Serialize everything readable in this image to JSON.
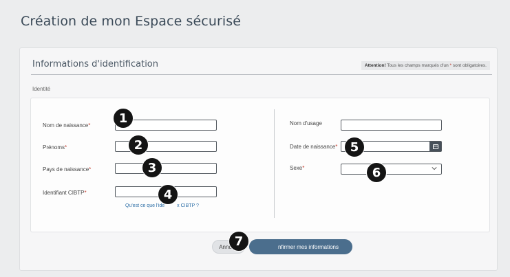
{
  "page": {
    "title": "Création de mon Espace sécurisé"
  },
  "section": {
    "title": "Informations d'identification",
    "note_bold": "Attention!",
    "note_pre": " Tous les champs marqués d'un ",
    "note_star": "*",
    "note_post": " sont obligatoires.",
    "subsection": "Identité"
  },
  "fields": {
    "nom_naissance": {
      "label": "Nom de naissance",
      "value": ""
    },
    "prenoms": {
      "label": "Prénoms",
      "value": ""
    },
    "pays_naissance": {
      "label": "Pays de naissance",
      "value": ""
    },
    "identifiant_cibtp": {
      "label": "Identifiant CIBTP",
      "value": ""
    },
    "help_link": "Qu'est ce que l'ide",
    "help_link_end": "x CIBTP ?",
    "nom_usage": {
      "label": "Nom d'usage",
      "value": ""
    },
    "date_naissance": {
      "label": "Date de naissance",
      "value": ""
    },
    "sexe": {
      "label": "Sexe",
      "value": ""
    }
  },
  "required_star": "*",
  "buttons": {
    "annuler": "Annuler",
    "confirm": "nfirmer mes informations"
  },
  "markers": [
    "1",
    "2",
    "3",
    "4",
    "5",
    "6",
    "7"
  ]
}
